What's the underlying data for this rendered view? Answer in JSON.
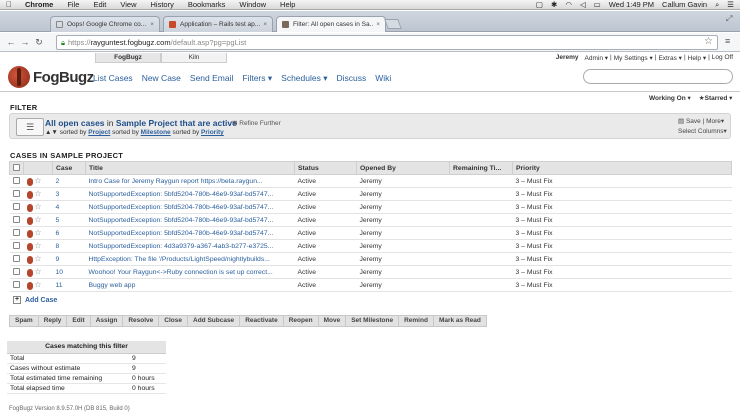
{
  "menubar": {
    "apple": "",
    "items": [
      "Chrome",
      "File",
      "Edit",
      "View",
      "History",
      "Bookmarks",
      "Window",
      "Help"
    ],
    "clock": "Wed 1:49 PM",
    "user": "Callum Gavin"
  },
  "tabs": [
    {
      "title": "Oops! Google Chrome co...",
      "favicon_color": "#ffffff"
    },
    {
      "title": "Application – Rails test ap...",
      "favicon_color": "#c94a2b"
    },
    {
      "title": "Filter: All open cases in Sa...",
      "favicon_color": "#7a6a5a"
    }
  ],
  "address": {
    "protocol": "https://",
    "host": "rayguntest.fogbugz.com",
    "path": "/default.asp?pg=pgList"
  },
  "fogbugz": {
    "product_tabs": [
      "FogBugz",
      "Kiln"
    ],
    "user_menu": {
      "user": "Jeremy",
      "items": [
        "Admin ▾",
        "|",
        "My Settings ▾",
        "|",
        "Extras ▾",
        "|",
        "Help ▾",
        "|",
        "Log Off"
      ]
    },
    "logo_text": "FogBugz",
    "nav": [
      "List Cases",
      "New Case",
      "Send Email",
      "Filters ▾",
      "Schedules ▾",
      "Discuss",
      "Wiki"
    ],
    "working_on": "Working On ▾",
    "starred": "★Starred ▾"
  },
  "filter": {
    "header": "FILTER",
    "title_link": "All open cases",
    "title_mid": "in",
    "title_project": "Sample Project",
    "title_tail": "that are active",
    "refine": "⊞ Refine Further",
    "sorted_prefix": "sorted by",
    "sort1": "Project",
    "sort_mid": "sorted by",
    "sort2": "Milestone",
    "sort_mid2": "sorted by",
    "sort3": "Priority",
    "save": "Save | More▾",
    "select_columns": "Select Columns▾"
  },
  "cases": {
    "header": "CASES IN SAMPLE PROJECT",
    "columns": [
      "",
      "",
      "Case",
      "Title",
      "Status",
      "Opened By",
      "Remaining Ti...",
      "Priority"
    ],
    "rows": [
      {
        "case": "2",
        "title": "Intro Case for Jeremy  Raygun report https://beta.raygun...",
        "status": "Active",
        "opened_by": "Jeremy",
        "remaining": "",
        "priority": "3 – Must Fix"
      },
      {
        "case": "3",
        "title": "NotSupportedException: 5bfd5204-780b-46e9-93af-bd5747...",
        "status": "Active",
        "opened_by": "Jeremy",
        "remaining": "",
        "priority": "3 – Must Fix"
      },
      {
        "case": "4",
        "title": "NotSupportedException: 5bfd5204-780b-46e9-93af-bd5747...",
        "status": "Active",
        "opened_by": "Jeremy",
        "remaining": "",
        "priority": "3 – Must Fix"
      },
      {
        "case": "5",
        "title": "NotSupportedException: 5bfd5204-780b-46e9-93af-bd5747...",
        "status": "Active",
        "opened_by": "Jeremy",
        "remaining": "",
        "priority": "3 – Must Fix"
      },
      {
        "case": "6",
        "title": "NotSupportedException: 5bfd5204-780b-46e9-93af-bd5747...",
        "status": "Active",
        "opened_by": "Jeremy",
        "remaining": "",
        "priority": "3 – Must Fix"
      },
      {
        "case": "8",
        "title": "NotSupportedException: 4d3a9379-a367-4ab3-b277-e3725...",
        "status": "Active",
        "opened_by": "Jeremy",
        "remaining": "",
        "priority": "3 – Must Fix"
      },
      {
        "case": "9",
        "title": "HttpException: The file '/Products/LightSpeed/nightlybuilds...",
        "status": "Active",
        "opened_by": "Jeremy",
        "remaining": "",
        "priority": "3 – Must Fix"
      },
      {
        "case": "10",
        "title": "Woohoo! Your Raygun<->Ruby connection is set up correct...",
        "status": "Active",
        "opened_by": "Jeremy",
        "remaining": "",
        "priority": "3 – Must Fix"
      },
      {
        "case": "11",
        "title": "Buggy web app",
        "status": "Active",
        "opened_by": "Jeremy",
        "remaining": "",
        "priority": "3 – Must Fix"
      }
    ],
    "add_case": "Add Case"
  },
  "actions": [
    "Spam",
    "Reply",
    "Edit",
    "Assign",
    "Resolve",
    "Close",
    "Add Subcase",
    "Reactivate",
    "Reopen",
    "Move",
    "Set Milestone",
    "Remind",
    "Mark as Read"
  ],
  "summary": {
    "header": "Cases matching this filter",
    "rows": [
      {
        "label": "Total",
        "value": "9"
      },
      {
        "label": "Cases without estimate",
        "value": "9"
      },
      {
        "label": "Total estimated time remaining",
        "value": "0 hours"
      },
      {
        "label": "Total elapsed time",
        "value": "0 hours"
      }
    ]
  },
  "footer": "FogBugz Version 8.9.57.0H (DB 815, Build 0)"
}
